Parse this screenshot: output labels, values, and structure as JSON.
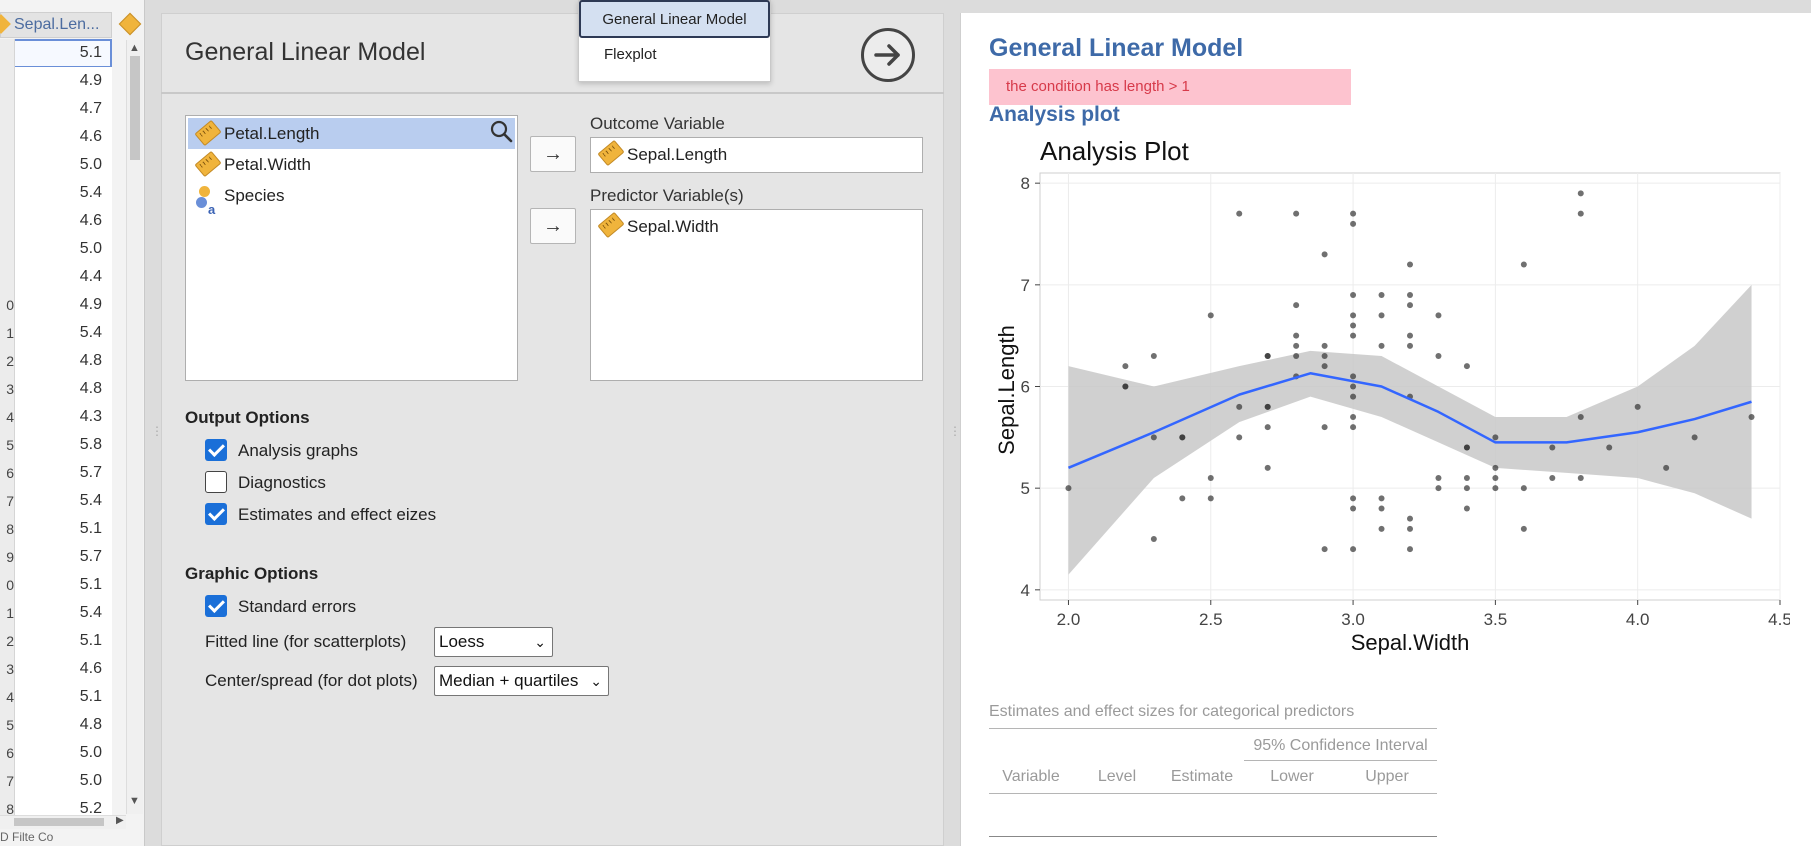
{
  "data_grid": {
    "column_header": "Sepal.Len...",
    "row_numbers": [
      "",
      "",
      "",
      "",
      "",
      "",
      "",
      "",
      "",
      "0",
      "1",
      "2",
      "3",
      "4",
      "5",
      "6",
      "7",
      "8",
      "9",
      "0",
      "1",
      "2",
      "3",
      "4",
      "5",
      "6",
      "7",
      "8"
    ],
    "values": [
      "5.1",
      "4.9",
      "4.7",
      "4.6",
      "5.0",
      "5.4",
      "4.6",
      "5.0",
      "4.4",
      "4.9",
      "5.4",
      "4.8",
      "4.8",
      "4.3",
      "5.8",
      "5.7",
      "5.4",
      "5.1",
      "5.7",
      "5.1",
      "5.4",
      "5.1",
      "4.6",
      "5.1",
      "4.8",
      "5.0",
      "5.0",
      "5.2"
    ],
    "footer": "D Filte   Co"
  },
  "menu": {
    "items": [
      "General Linear Model",
      "Flexplot"
    ]
  },
  "options": {
    "title": "General Linear Model",
    "variables": [
      "Petal.Length",
      "Petal.Width",
      "Species"
    ],
    "outcome_label": "Outcome Variable",
    "outcome_value": "Sepal.Length",
    "predictor_label": "Predictor Variable(s)",
    "predictor_value": "Sepal.Width",
    "arrow": "→",
    "output_options_label": "Output Options",
    "output_options": [
      {
        "label": "Analysis graphs",
        "checked": true
      },
      {
        "label": "Diagnostics",
        "checked": false
      },
      {
        "label": "Estimates and effect eizes",
        "checked": true
      }
    ],
    "graphic_options_label": "Graphic Options",
    "standard_errors": {
      "label": "Standard errors",
      "checked": true
    },
    "fitted_line_label": "Fitted line (for scatterplots)",
    "fitted_line_value": "Loess",
    "center_spread_label": "Center/spread (for dot plots)",
    "center_spread_value": "Median + quartiles"
  },
  "results": {
    "title": "General Linear Model",
    "error": "the condition has length > 1",
    "plot_heading": "Analysis plot",
    "table_caption": "Estimates and effect sizes for categorical predictors",
    "ci_header": "95% Confidence Interval",
    "columns": [
      "Variable",
      "Level",
      "Estimate",
      "Lower",
      "Upper"
    ]
  },
  "chart_data": {
    "type": "scatter",
    "title": "Analysis Plot",
    "xlabel": "Sepal.Width",
    "ylabel": "Sepal.Length",
    "xlim": [
      1.9,
      4.5
    ],
    "ylim": [
      3.9,
      8.1
    ],
    "xticks": [
      2.0,
      2.5,
      3.0,
      3.5,
      4.0,
      4.5
    ],
    "yticks": [
      4,
      5,
      6,
      7,
      8
    ],
    "grid": true,
    "point_color": "#333333",
    "line_color": "#3366ff",
    "band_color": "#c8c8c8",
    "points": [
      [
        2.0,
        5.0
      ],
      [
        2.2,
        6.2
      ],
      [
        2.2,
        6.0
      ],
      [
        2.2,
        6.0
      ],
      [
        2.3,
        5.5
      ],
      [
        2.3,
        6.3
      ],
      [
        2.3,
        4.5
      ],
      [
        2.4,
        4.9
      ],
      [
        2.4,
        5.5
      ],
      [
        2.4,
        5.5
      ],
      [
        2.5,
        6.7
      ],
      [
        2.5,
        5.1
      ],
      [
        2.5,
        4.9
      ],
      [
        2.6,
        7.7
      ],
      [
        2.6,
        5.8
      ],
      [
        2.6,
        5.5
      ],
      [
        2.7,
        6.3
      ],
      [
        2.7,
        6.3
      ],
      [
        2.7,
        5.6
      ],
      [
        2.7,
        5.8
      ],
      [
        2.7,
        5.8
      ],
      [
        2.7,
        5.2
      ],
      [
        2.8,
        7.7
      ],
      [
        2.8,
        6.8
      ],
      [
        2.8,
        6.4
      ],
      [
        2.8,
        6.3
      ],
      [
        2.8,
        6.1
      ],
      [
        2.8,
        6.5
      ],
      [
        2.9,
        7.3
      ],
      [
        2.9,
        6.2
      ],
      [
        2.9,
        6.3
      ],
      [
        2.9,
        5.6
      ],
      [
        2.9,
        4.4
      ],
      [
        2.9,
        6.4
      ],
      [
        3.0,
        7.7
      ],
      [
        3.0,
        7.6
      ],
      [
        3.0,
        6.9
      ],
      [
        3.0,
        6.7
      ],
      [
        3.0,
        6.6
      ],
      [
        3.0,
        6.5
      ],
      [
        3.0,
        6.1
      ],
      [
        3.0,
        6.0
      ],
      [
        3.0,
        5.9
      ],
      [
        3.0,
        5.7
      ],
      [
        3.0,
        5.6
      ],
      [
        3.0,
        4.4
      ],
      [
        3.0,
        4.8
      ],
      [
        3.0,
        4.9
      ],
      [
        3.1,
        6.9
      ],
      [
        3.1,
        6.7
      ],
      [
        3.1,
        6.4
      ],
      [
        3.1,
        4.9
      ],
      [
        3.1,
        4.8
      ],
      [
        3.1,
        4.6
      ],
      [
        3.2,
        7.2
      ],
      [
        3.2,
        6.9
      ],
      [
        3.2,
        6.8
      ],
      [
        3.2,
        6.5
      ],
      [
        3.2,
        6.4
      ],
      [
        3.2,
        5.9
      ],
      [
        3.2,
        4.7
      ],
      [
        3.2,
        4.6
      ],
      [
        3.2,
        4.4
      ],
      [
        3.3,
        6.7
      ],
      [
        3.3,
        6.3
      ],
      [
        3.3,
        5.1
      ],
      [
        3.3,
        5.0
      ],
      [
        3.4,
        6.2
      ],
      [
        3.4,
        5.4
      ],
      [
        3.4,
        5.4
      ],
      [
        3.4,
        5.1
      ],
      [
        3.4,
        5.0
      ],
      [
        3.4,
        4.8
      ],
      [
        3.5,
        5.5
      ],
      [
        3.5,
        5.0
      ],
      [
        3.5,
        5.1
      ],
      [
        3.5,
        5.2
      ],
      [
        3.6,
        7.2
      ],
      [
        3.6,
        5.0
      ],
      [
        3.6,
        4.6
      ],
      [
        3.7,
        5.4
      ],
      [
        3.7,
        5.1
      ],
      [
        3.8,
        7.9
      ],
      [
        3.8,
        7.7
      ],
      [
        3.8,
        5.7
      ],
      [
        3.8,
        5.1
      ],
      [
        3.9,
        5.4
      ],
      [
        4.0,
        5.8
      ],
      [
        4.1,
        5.2
      ],
      [
        4.2,
        5.5
      ],
      [
        4.4,
        5.7
      ]
    ],
    "smooth": [
      [
        2.0,
        5.2
      ],
      [
        2.3,
        5.55
      ],
      [
        2.6,
        5.92
      ],
      [
        2.85,
        6.13
      ],
      [
        3.1,
        6.0
      ],
      [
        3.3,
        5.75
      ],
      [
        3.5,
        5.45
      ],
      [
        3.75,
        5.45
      ],
      [
        4.0,
        5.55
      ],
      [
        4.2,
        5.68
      ],
      [
        4.4,
        5.85
      ]
    ],
    "band_upper": [
      [
        2.0,
        6.2
      ],
      [
        2.3,
        6.0
      ],
      [
        2.6,
        6.2
      ],
      [
        2.85,
        6.35
      ],
      [
        3.1,
        6.3
      ],
      [
        3.3,
        6.0
      ],
      [
        3.5,
        5.7
      ],
      [
        3.75,
        5.7
      ],
      [
        4.0,
        6.0
      ],
      [
        4.2,
        6.4
      ],
      [
        4.4,
        7.0
      ]
    ],
    "band_lower": [
      [
        2.0,
        4.15
      ],
      [
        2.3,
        5.1
      ],
      [
        2.6,
        5.65
      ],
      [
        2.85,
        5.9
      ],
      [
        3.1,
        5.7
      ],
      [
        3.3,
        5.45
      ],
      [
        3.5,
        5.2
      ],
      [
        3.75,
        5.15
      ],
      [
        4.0,
        5.1
      ],
      [
        4.2,
        4.95
      ],
      [
        4.4,
        4.7
      ]
    ]
  }
}
